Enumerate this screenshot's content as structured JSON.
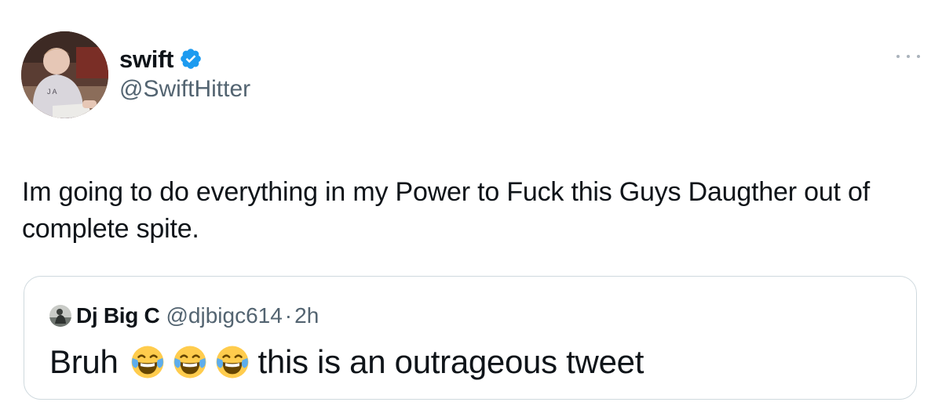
{
  "tweet": {
    "author": {
      "display_name": "swift",
      "handle": "@SwiftHitter",
      "verified": true,
      "avatar_icon": "profile-photo-icon"
    },
    "more_icon": "more-options-icon",
    "text": "Im going to do everything in my Power to Fuck this Guys Daugther out of complete spite.",
    "quoted_tweet": {
      "display_name": "Dj Big C",
      "handle": "@djbigc614",
      "separator": "·",
      "time": "2h",
      "text_start": "Bruh",
      "emojis": [
        "😂",
        "😂",
        "😂"
      ],
      "text_end": "this is an outrageous tweet"
    }
  },
  "colors": {
    "text": "#0f1419",
    "secondary": "#536471",
    "verified": "#1d9bf0",
    "border": "#cfd9de"
  }
}
